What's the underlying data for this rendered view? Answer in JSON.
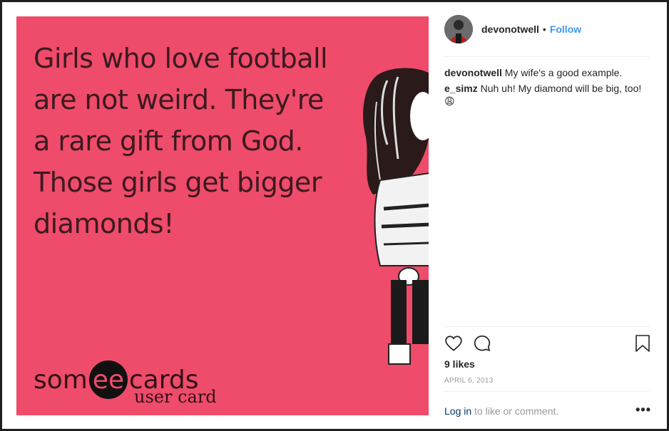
{
  "image": {
    "ecard_lines": [
      "Girls who love football",
      "are not weird. They're",
      "a rare gift from God.",
      "Those girls get bigger",
      "diamonds!"
    ],
    "logo_left": "som",
    "logo_mid": "ee",
    "logo_right": "cards",
    "logo_sub": "user card"
  },
  "post": {
    "username": "devonotwell",
    "separator": "•",
    "follow_label": "Follow",
    "comments": [
      {
        "user": "devonotwell",
        "text": "My wife's a good example."
      },
      {
        "user": "e_simz",
        "text": "Nuh uh! My diamond will be big, too! 😩"
      }
    ],
    "likes": "9 likes",
    "date": "APRIL 6, 2013",
    "login_link": "Log in",
    "login_suffix": " to like or comment.",
    "more_label": "•••"
  },
  "colors": {
    "ecard_bg": "#ef4b6a",
    "link": "#3897f0"
  },
  "icons": [
    "heart-icon",
    "comment-icon",
    "bookmark-icon",
    "more-options-icon"
  ]
}
